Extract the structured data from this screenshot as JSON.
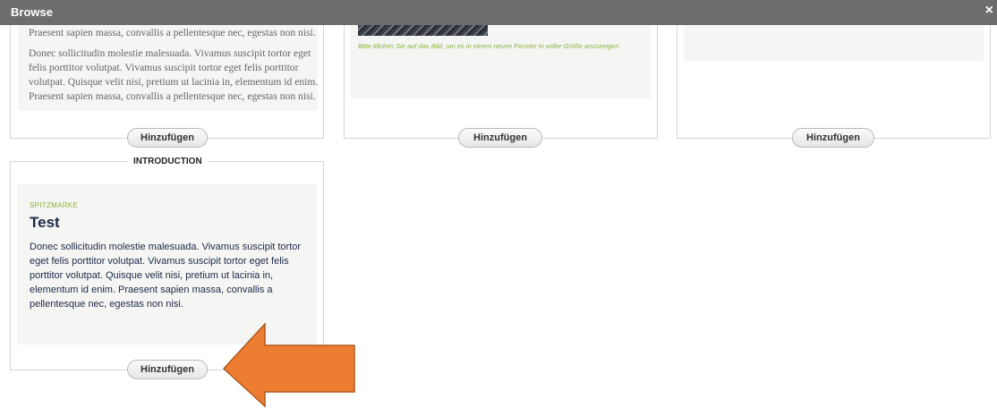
{
  "dialog": {
    "title": "Browse",
    "close_glyph": "×"
  },
  "cards": {
    "card1": {
      "text_top": "Praesent sapien massa, convallis a pellentesque nec, egestas non nisi.",
      "text_body": "Donec sollicitudin molestie malesuada. Vivamus suscipit tortor eget felis porttitor volutpat. Vivamus suscipit tortor eget felis porttitor volutpat. Quisque velit nisi, pretium ut lacinia in, elementum id enim. Praesent sapien massa, convallis a pellentesque nec, egestas non nisi.",
      "button": "Hinzufügen"
    },
    "card2": {
      "caption": "Bitte klicken Sie auf das Bild, um es in einem neuen Fenster in voller Größe anzuzeigen.",
      "button": "Hinzufügen"
    },
    "card3": {
      "button": "Hinzufügen"
    },
    "card4": {
      "header": "INTRODUCTION",
      "kicker": "SPITZMARKE",
      "heading": "Test",
      "body": "Donec sollicitudin molestie malesuada. Vivamus suscipit tortor eget felis porttitor volutpat. Vivamus suscipit tortor eget felis porttitor volutpat. Quisque velit nisi, pretium ut lacinia in, elementum id enim. Praesent sapien massa, convallis a pellentesque nec, egestas non nisi.",
      "button": "Hinzufügen"
    }
  },
  "colors": {
    "arrow_fill": "#ed7d31",
    "arrow_stroke": "#ae5a21",
    "accent_green": "#8ab43a",
    "header_bar": "#6d6d6d"
  }
}
